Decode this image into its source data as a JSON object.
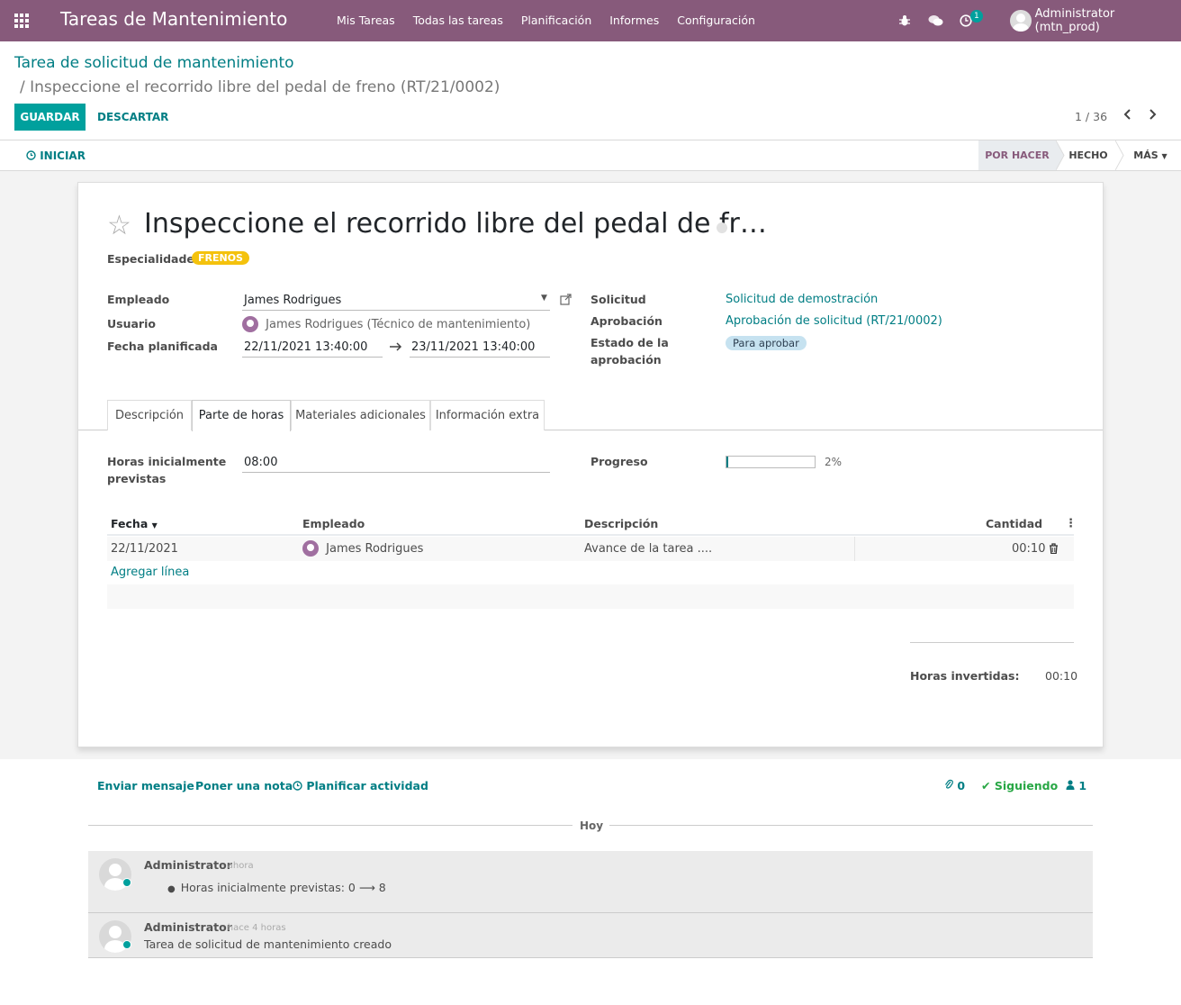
{
  "topbar": {
    "app_name": "Tareas de Mantenimiento",
    "menu": [
      "Mis Tareas",
      "Todas las tareas",
      "Planificación",
      "Informes",
      "Configuración"
    ],
    "activity_count": "1",
    "user": "Administrator (mtn_prod)"
  },
  "breadcrumb": {
    "parent": "Tarea de solicitud de mantenimiento",
    "current": "/ Inspeccione el recorrido libre del pedal de freno (RT/21/0002)"
  },
  "buttons": {
    "save": "GUARDAR",
    "discard": "DESCARTAR",
    "start": "INICIAR"
  },
  "pager": {
    "value": "1 / 36"
  },
  "stages": {
    "active": "POR HACER",
    "done": "HECHO",
    "more": "MÁS"
  },
  "form": {
    "title": "Inspeccione el recorrido libre del pedal de fr…",
    "specialties_label": "Especialidades",
    "specialty_tag": "FRENOS",
    "employee_label": "Empleado",
    "employee_value": "James Rodrigues",
    "user_label": "Usuario",
    "user_value": "James Rodrigues (Técnico de mantenimiento)",
    "planned_date_label": "Fecha planificada",
    "planned_start": "22/11/2021 13:40:00",
    "planned_end": "23/11/2021 13:40:00",
    "request_label": "Solicitud",
    "request_value": "Solicitud de demostración",
    "approval_label": "Aprobación",
    "approval_value": "Aprobación de solicitud (RT/21/0002)",
    "approval_state_label_1": "Estado de la",
    "approval_state_label_2": "aprobación",
    "approval_state_value": "Para aprobar"
  },
  "tabs": [
    "Descripción",
    "Parte de horas",
    "Materiales adicionales",
    "Información extra"
  ],
  "timesheet": {
    "planned_hours_label_1": "Horas inicialmente",
    "planned_hours_label_2": "previstas",
    "planned_hours_value": "08:00",
    "progress_label": "Progreso",
    "progress_value": 0.02,
    "progress_text": "2%",
    "columns": [
      "Fecha",
      "Empleado",
      "Descripción",
      "Cantidad"
    ],
    "rows": [
      {
        "date": "22/11/2021",
        "employee": "James Rodrigues",
        "description": "Avance de la tarea ....",
        "quantity": "00:10"
      }
    ],
    "add_line": "Agregar línea",
    "spent_label": "Horas invertidas:",
    "spent_value": "00:10"
  },
  "chatter": {
    "send_message": "Enviar mensaje",
    "log_note": "Poner una nota",
    "schedule_activity": "Planificar actividad",
    "attachments": "0",
    "following": "Siguiendo",
    "followers": "1",
    "day_separator": "Hoy",
    "messages": [
      {
        "author": "Administrator",
        "when": "- ahora",
        "body": "Horas inicialmente previstas: 0 ⟶ 8"
      },
      {
        "author": "Administrator",
        "when": "- hace 4 horas",
        "body": "Tarea de solicitud de mantenimiento creado"
      }
    ]
  }
}
